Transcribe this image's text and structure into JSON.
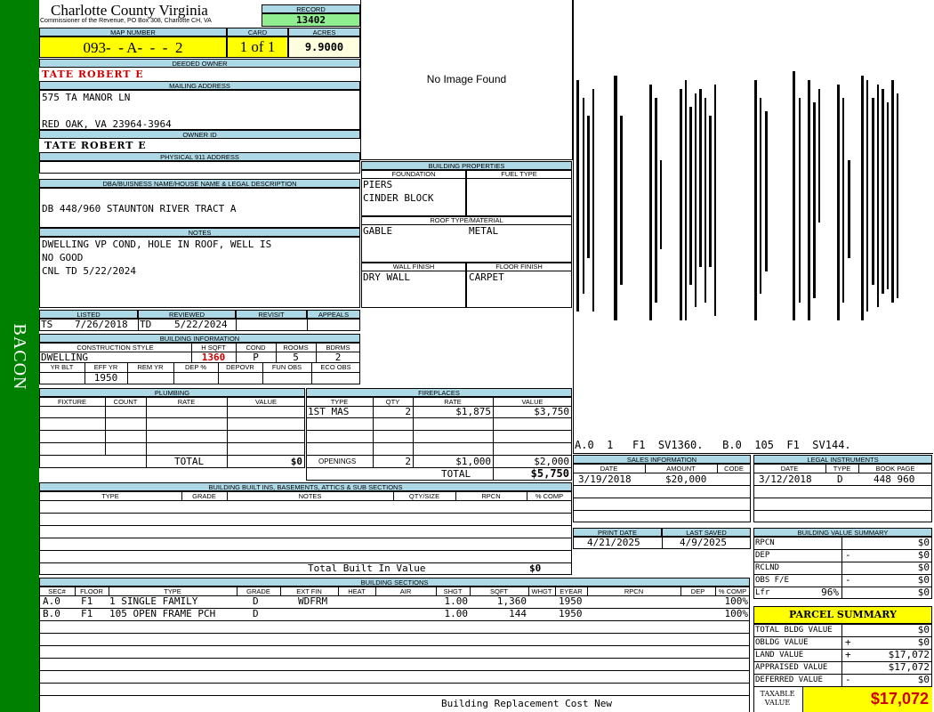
{
  "sidebar": {
    "label": "BACON",
    "color": "#008000"
  },
  "header": {
    "county": "Charlotte County Virginia",
    "commissioner": "Commissioner of the Revenue, PO Box 308, Charlotte CH, VA",
    "record_label": "RECORD",
    "record": "13402",
    "map_label": "MAP NUMBER",
    "map": "093-  - A-  -  -  2",
    "card_label": "CARD",
    "card": "1 of 1",
    "acres_label": "ACRES",
    "acres": "9.9000"
  },
  "owner": {
    "deeded_label": "DEEDED OWNER",
    "deeded": "TATE ROBERT E",
    "mailing_label": "MAILING ADDRESS",
    "mail1": "575 TA MANOR LN",
    "mail2": "RED OAK, VA 23964-3964",
    "ownerid_label": "OWNER ID",
    "ownerid": "TATE ROBERT E",
    "phys_label": "PHYSICAL 911 ADDRESS",
    "phys": ""
  },
  "legal": {
    "label": "DBA/BUISNESS NAME/HOUSE NAME & LEGAL DESCRIPTION",
    "text": "DB 448/960 STAUNTON RIVER TRACT A"
  },
  "notes": {
    "label": "NOTES",
    "l1": "DWELLING VP COND, HOLE IN ROOF, WELL IS",
    "l2": "NO GOOD",
    "l3": "CNL TD 5/22/2024"
  },
  "image": {
    "text": "No Image Found"
  },
  "props": {
    "label": "BUILDING PROPERTIES",
    "foundation_label": "FOUNDATION",
    "fuel_label": "FUEL TYPE",
    "f1": "PIERS",
    "f2": "CINDER BLOCK",
    "roof_label": "ROOF TYPE/MATERIAL",
    "roof_type": "GABLE",
    "roof_mat": "METAL",
    "wall_label": "WALL FINISH",
    "floor_label": "FLOOR FINISH",
    "wall": "DRY WALL",
    "floor": "CARPET"
  },
  "sketch": {
    "caption": "A.0  1   F1  SV1360.   B.0  105  F1  SV144."
  },
  "listing": {
    "listed_label": "LISTED",
    "reviewed_label": "REVIEWED",
    "revisit_label": "REVISIT",
    "appeals_label": "APPEALS",
    "listed_by": "TS",
    "listed_date": "7/26/2018",
    "reviewed_by": "TD",
    "reviewed_date": "5/22/2024"
  },
  "bldg_info": {
    "label": "BUILDING INFORMATION",
    "cs_label": "CONSTRUCTION STYLE",
    "hsqft_label": "H SQFT",
    "cond_label": "COND",
    "rooms_label": "ROOMS",
    "bdrms_label": "BDRMS",
    "style": "DWELLING",
    "hsqft": "1360",
    "cond": "P",
    "rooms": "5",
    "bdrms": "2",
    "yrblt_label": "YR BLT",
    "effyr_label": "EFF YR",
    "remyr_label": "REM YR",
    "dep_label": "DEP %",
    "depovr_label": "DEPOVR",
    "funobs_label": "FUN OBS",
    "ecoobs_label": "ECO OBS",
    "effyr": "1950"
  },
  "plumbing": {
    "label": "PLUMBING",
    "fixture_label": "FIXTURE",
    "count_label": "COUNT",
    "rate_label": "RATE",
    "value_label": "VALUE",
    "total_label": "TOTAL",
    "total": "$0"
  },
  "fireplaces": {
    "label": "FIREPLACES",
    "type_label": "TYPE",
    "qty_label": "QTY",
    "rate_label": "RATE",
    "value_label": "VALUE",
    "type": "1ST MAS",
    "qty": "2",
    "rate": "$1,875",
    "value": "$3,750",
    "openings_label": "OPENINGS",
    "open_qty": "2",
    "open_rate": "$1,000",
    "open_value": "$2,000",
    "total_label": "TOTAL",
    "total": "$5,750"
  },
  "sales": {
    "label": "SALES INFORMATION",
    "date_label": "DATE",
    "amount_label": "AMOUNT",
    "code_label": "CODE",
    "date": "3/19/2018",
    "amount": "$20,000"
  },
  "legalinst": {
    "label": "LEGAL INSTRUMENTS",
    "date_label": "DATE",
    "type_label": "TYPE",
    "book_label": "BOOK PAGE",
    "date": "3/12/2018",
    "type": "D",
    "book": "448 960"
  },
  "builtins": {
    "label": "BUILDING BUILT INS, BASEMENTS, ATTICS & SUB SECTIONS",
    "type_label": "TYPE",
    "grade_label": "GRADE",
    "notes_label": "NOTES",
    "qty_label": "QTY/SIZE",
    "rpcn_label": "RPCN",
    "comp_label": "% COMP",
    "total_label": "Total Built In Value",
    "total": "$0"
  },
  "dates": {
    "print_label": "PRINT DATE",
    "saved_label": "LAST SAVED",
    "print": "4/21/2025",
    "saved": "4/9/2025"
  },
  "value_summary": {
    "label": "BUILDING VALUE SUMMARY",
    "rows": [
      {
        "k": "RPCN",
        "s": "",
        "v": "$0"
      },
      {
        "k": "DEP",
        "s": "-",
        "v": "$0"
      },
      {
        "k": "RCLND",
        "s": "",
        "v": "$0"
      },
      {
        "k": "OBS F/E",
        "s": "-",
        "v": "$0"
      },
      {
        "k": "Lfr",
        "p": "96%",
        "v": "$0"
      }
    ]
  },
  "sections": {
    "label": "BUILDING SECTIONS",
    "cols": [
      "SEC#",
      "FLOOR",
      "TYPE",
      "GRADE",
      "EXT FIN",
      "HEAT",
      "AIR",
      "SHGT",
      "SQFT",
      "WHGT",
      "EYEAR",
      "RPCN",
      "DEP",
      "% COMP"
    ],
    "rows": [
      {
        "sec": "A.0",
        "floor": "F1",
        "type": "1 SINGLE FAMILY",
        "grade": "D",
        "ext": "WDFRM",
        "shgt": "1.00",
        "sqft": "1,360",
        "eyear": "1950",
        "comp": "100%"
      },
      {
        "sec": "B.0",
        "floor": "F1",
        "type": "105 OPEN FRAME PCH",
        "grade": "D",
        "ext": "",
        "shgt": "1.00",
        "sqft": "144",
        "eyear": "1950",
        "comp": "100%"
      }
    ],
    "footer": "Building Replacement Cost New"
  },
  "parcel": {
    "label": "PARCEL SUMMARY",
    "rows": [
      {
        "k": "TOTAL BLDG VALUE",
        "s": "",
        "v": "$0"
      },
      {
        "k": "OBLDG VALUE",
        "s": "+",
        "v": "$0"
      },
      {
        "k": "LAND VALUE",
        "s": "+",
        "v": "$17,072"
      },
      {
        "k": "APPRAISED VALUE",
        "s": "",
        "v": "$17,072"
      },
      {
        "k": "DEFERRED VALUE",
        "s": "-",
        "v": "$0"
      }
    ],
    "taxable_l1": "TAXABLE",
    "taxable_l2": "VALUE",
    "taxable": "$17,072"
  }
}
